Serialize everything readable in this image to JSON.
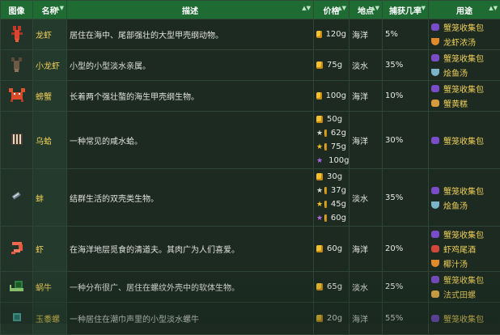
{
  "headers": {
    "image": "图像",
    "name": "名称",
    "desc": "描述",
    "price": "价格",
    "location": "地点",
    "catch_rate": "捕获几率",
    "uses": "用途"
  },
  "rows": [
    {
      "name": "龙虾",
      "desc": "居住在海中、尾部强壮的大型甲壳纲动物。",
      "prices": [
        {
          "star": "none",
          "value": "120g"
        }
      ],
      "location": "海洋",
      "rate": "5%",
      "uses": [
        {
          "icon": "purple",
          "label": "蟹笼收集包"
        },
        {
          "icon": "orange",
          "label": "龙虾浓汤"
        }
      ]
    },
    {
      "name": "小龙虾",
      "desc": "小型的小型淡水亲属。",
      "prices": [
        {
          "star": "none",
          "value": "75g"
        }
      ],
      "location": "淡水",
      "rate": "35%",
      "uses": [
        {
          "icon": "purple",
          "label": "蟹笼收集包"
        },
        {
          "icon": "bowl",
          "label": "烩鱼汤"
        }
      ]
    },
    {
      "name": "螃蟹",
      "desc": "长着两个强壮螯的海生甲壳纲生物。",
      "prices": [
        {
          "star": "none",
          "value": "100g"
        }
      ],
      "location": "海洋",
      "rate": "10%",
      "uses": [
        {
          "icon": "purple",
          "label": "蟹笼收集包"
        },
        {
          "icon": "cake",
          "label": "蟹黄糕"
        }
      ]
    },
    {
      "name": "乌蛤",
      "desc": "一种常见的咸水蛤。",
      "prices": [
        {
          "star": "none",
          "value": "50g"
        },
        {
          "star": "silver",
          "value": "62g"
        },
        {
          "star": "gold",
          "value": "75g"
        },
        {
          "star": "iridium",
          "value": "100g"
        }
      ],
      "location": "海洋",
      "rate": "30%",
      "uses": [
        {
          "icon": "purple",
          "label": "蟹笼收集包"
        }
      ]
    },
    {
      "name": "蚌",
      "desc": "结群生活的双壳类生物。",
      "prices": [
        {
          "star": "none",
          "value": "30g"
        },
        {
          "star": "silver",
          "value": "37g"
        },
        {
          "star": "gold",
          "value": "45g"
        },
        {
          "star": "iridium",
          "value": "60g"
        }
      ],
      "location": "淡水",
      "rate": "35%",
      "uses": [
        {
          "icon": "purple",
          "label": "蟹笼收集包"
        },
        {
          "icon": "bowl",
          "label": "烩鱼汤"
        }
      ]
    },
    {
      "name": "虾",
      "desc": "在海洋地层觅食的清道夫。其肉广为人们喜爱。",
      "prices": [
        {
          "star": "none",
          "value": "60g"
        }
      ],
      "location": "海洋",
      "rate": "20%",
      "uses": [
        {
          "icon": "purple",
          "label": "蟹笼收集包"
        },
        {
          "icon": "drink",
          "label": "虾鸡尾酒"
        },
        {
          "icon": "orange",
          "label": "椰汁汤"
        }
      ]
    },
    {
      "name": "蜗牛",
      "desc": "一种分布很广、居住在螺纹外壳中的软体生物。",
      "prices": [
        {
          "star": "none",
          "value": "65g"
        }
      ],
      "location": "淡水",
      "rate": "25%",
      "uses": [
        {
          "icon": "purple",
          "label": "蟹笼收集包"
        },
        {
          "icon": "snail",
          "label": "法式田螺"
        }
      ]
    },
    {
      "name": "玉黍螺",
      "desc": "一种居住在潮巾声里的小型淡水螺牛",
      "prices": [
        {
          "star": "none",
          "value": "20g"
        }
      ],
      "location": "海洋",
      "rate": "55%",
      "uses": [
        {
          "icon": "purple",
          "label": "蟹笼收集包"
        }
      ]
    }
  ],
  "colors": {
    "header_bg": "#1f6b34",
    "name_text": "#f2d15a",
    "body_bg": "#1c2a21"
  }
}
